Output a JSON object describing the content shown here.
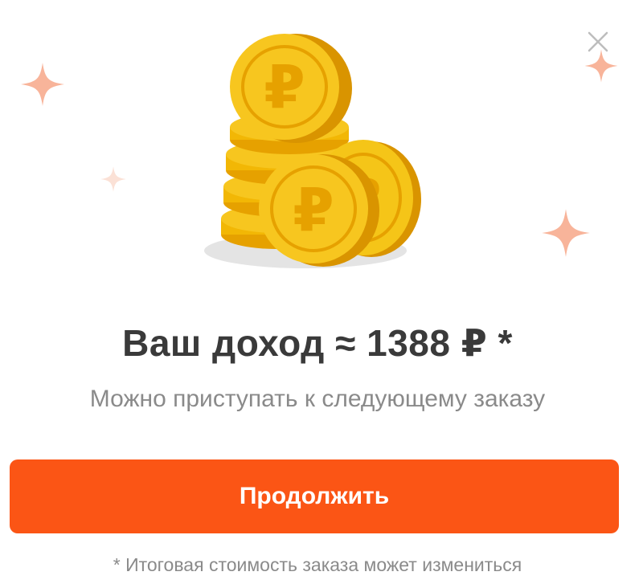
{
  "modal": {
    "title": "Ваш доход ≈ 1388 ₽ *",
    "subtitle": "Можно приступать к следующему заказу",
    "continue_label": "Продолжить",
    "footnote": "* Итоговая стоимость заказа может измениться"
  },
  "icons": {
    "close": "close-icon",
    "illustration": "ruble-coins-icon",
    "sparkle": "sparkle-icon"
  },
  "colors": {
    "accent": "#fb5515",
    "title": "#3a3a3a",
    "muted": "#8a8a8a",
    "sparkle": "#f8b49a",
    "coin": "#f5c518",
    "coin_edge": "#e6a100"
  }
}
